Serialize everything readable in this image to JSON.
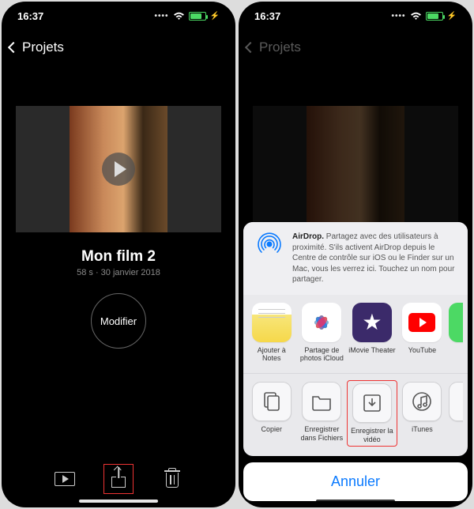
{
  "statusbar": {
    "time": "16:37"
  },
  "nav": {
    "back_label": "Projets"
  },
  "project": {
    "title": "Mon film 2",
    "subtitle": "58 s · 30 janvier 2018",
    "modify_label": "Modifier"
  },
  "airdrop": {
    "title": "AirDrop.",
    "desc": "Partagez avec des utilisateurs à proximité. S'ils activent AirDrop depuis le Centre de contrôle sur iOS ou le Finder sur un Mac, vous les verrez ici. Touchez un nom pour partager."
  },
  "share_row1": [
    {
      "label": "Ajouter à Notes"
    },
    {
      "label": "Partage de photos iCloud"
    },
    {
      "label": "iMovie Theater"
    },
    {
      "label": "YouTube"
    }
  ],
  "share_row2": [
    {
      "label": "Copier"
    },
    {
      "label": "Enregistrer dans Fichiers"
    },
    {
      "label": "Enregistrer la vidéo"
    },
    {
      "label": "iTunes"
    }
  ],
  "cancel_label": "Annuler"
}
